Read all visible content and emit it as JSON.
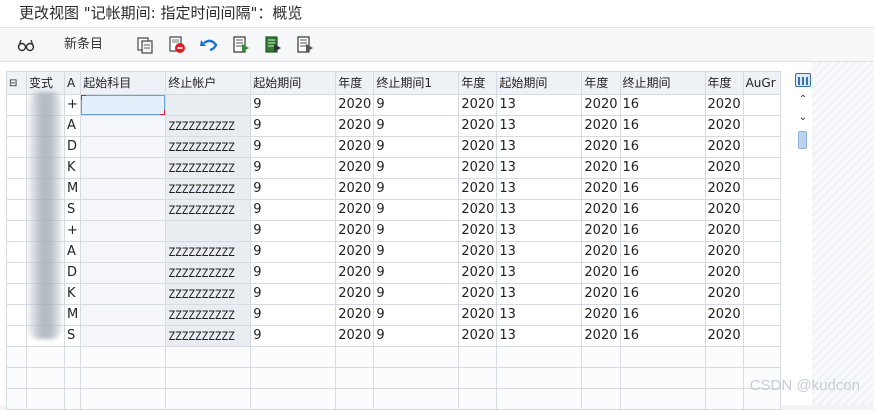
{
  "title": "更改视图 \"记帐期间: 指定时间间隔\"：概览",
  "toolbar": {
    "new_entries_label": "新条目",
    "icons": [
      "glasses-icon",
      "copy-icon",
      "delete-icon",
      "undo-icon",
      "select-all-icon",
      "select-block-icon",
      "deselect-icon"
    ]
  },
  "table": {
    "columns": [
      "",
      "变式",
      "A",
      "起始科目",
      "终止帐户",
      "起始期间",
      "年度",
      "终止期间1",
      "年度",
      "起始期间",
      "年度",
      "终止期间",
      "年度",
      "AuGr"
    ],
    "rows": [
      [
        "",
        "",
        "+",
        "",
        "",
        "9",
        "2020",
        "9",
        "2020",
        "13",
        "2020",
        "16",
        "2020",
        ""
      ],
      [
        "",
        "",
        "A",
        "",
        "ZZZZZZZZZZ",
        "9",
        "2020",
        "9",
        "2020",
        "13",
        "2020",
        "16",
        "2020",
        ""
      ],
      [
        "",
        "",
        "D",
        "",
        "ZZZZZZZZZZ",
        "9",
        "2020",
        "9",
        "2020",
        "13",
        "2020",
        "16",
        "2020",
        ""
      ],
      [
        "",
        "",
        "K",
        "",
        "ZZZZZZZZZZ",
        "9",
        "2020",
        "9",
        "2020",
        "13",
        "2020",
        "16",
        "2020",
        ""
      ],
      [
        "",
        "",
        "M",
        "",
        "ZZZZZZZZZZ",
        "9",
        "2020",
        "9",
        "2020",
        "13",
        "2020",
        "16",
        "2020",
        ""
      ],
      [
        "",
        "",
        "S",
        "",
        "ZZZZZZZZZZ",
        "9",
        "2020",
        "9",
        "2020",
        "13",
        "2020",
        "16",
        "2020",
        ""
      ],
      [
        "",
        "",
        "+",
        "",
        "",
        "9",
        "2020",
        "9",
        "2020",
        "13",
        "2020",
        "16",
        "2020",
        ""
      ],
      [
        "",
        "",
        "A",
        "",
        "ZZZZZZZZZZ",
        "9",
        "2020",
        "9",
        "2020",
        "13",
        "2020",
        "16",
        "2020",
        ""
      ],
      [
        "",
        "",
        "D",
        "",
        "ZZZZZZZZZZ",
        "9",
        "2020",
        "9",
        "2020",
        "13",
        "2020",
        "16",
        "2020",
        ""
      ],
      [
        "",
        "",
        "K",
        "",
        "ZZZZZZZZZZ",
        "9",
        "2020",
        "9",
        "2020",
        "13",
        "2020",
        "16",
        "2020",
        ""
      ],
      [
        "",
        "",
        "M",
        "",
        "ZZZZZZZZZZ",
        "9",
        "2020",
        "9",
        "2020",
        "13",
        "2020",
        "16",
        "2020",
        ""
      ],
      [
        "",
        "",
        "S",
        "",
        "ZZZZZZZZZZ",
        "9",
        "2020",
        "9",
        "2020",
        "13",
        "2020",
        "16",
        "2020",
        ""
      ]
    ],
    "empty_rows": 3
  },
  "watermark": "CSDN @kudcon",
  "colors": {
    "focus_border": "#6aa2d8",
    "focus_marker": "#d8202a",
    "header_bg": "#eef1f5",
    "readonly_bg": "#e9edf2"
  }
}
